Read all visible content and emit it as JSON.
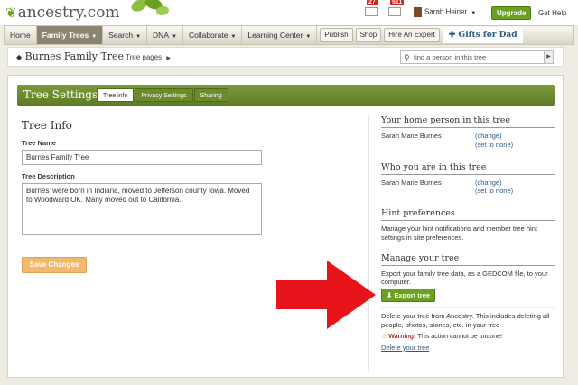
{
  "brand": {
    "logo_mark": "❦",
    "logo_text": "ancestry.com"
  },
  "header": {
    "notifications": [
      {
        "count": "27",
        "icon": "envelope-icon"
      },
      {
        "count": "511",
        "icon": "envelope-icon"
      }
    ],
    "user_name": "Sarah Heiner",
    "upgrade_label": "Upgrade",
    "help_label": "Get Help"
  },
  "nav": {
    "items": [
      {
        "label": "Home",
        "dropdown": false
      },
      {
        "label": "Family Trees",
        "dropdown": true,
        "active": true
      },
      {
        "label": "Search",
        "dropdown": true
      },
      {
        "label": "DNA",
        "dropdown": true
      },
      {
        "label": "Collaborate",
        "dropdown": true
      },
      {
        "label": "Learning Center",
        "dropdown": true
      }
    ],
    "publish_label": "Publish",
    "shop_label": "Shop",
    "hire_label": "Hire An Expert",
    "promo_label": "Gifts for Dad",
    "caret": "▼"
  },
  "subbar": {
    "tree_name": "Burnes Family Tree",
    "tree_pages_label": "Tree pages",
    "search_placeholder": "find a person in this tree"
  },
  "panel": {
    "title": "Tree Settings",
    "tabs": [
      {
        "label": "Tree info",
        "active": true
      },
      {
        "label": "Privacy Settings"
      },
      {
        "label": "Sharing"
      }
    ]
  },
  "tree_info": {
    "heading": "Tree Info",
    "name_label": "Tree Name",
    "name_value": "Burnes Family Tree",
    "desc_label": "Tree Description",
    "desc_value": "Burnes' were born in Indiana, moved to Jefferson county Iowa. Moved to Woodward OK. Many moved out to California.",
    "save_label": "Save Changes"
  },
  "sidebar": {
    "home_person": {
      "heading": "Your home person in this tree",
      "name": "Sarah Marie Burnes",
      "change": "(change)",
      "set_none": "(set to none)"
    },
    "who_you_are": {
      "heading": "Who you are in this tree",
      "name": "Sarah Marie Burnes",
      "change": "(change)",
      "set_none": "(set to none)"
    },
    "hints": {
      "heading": "Hint preferences",
      "text": "Manage your hint notifications and member tree hint settings in site preferences."
    },
    "manage": {
      "heading": "Manage your tree",
      "export_text": "Export your family tree data, as a GEDCOM file, to your computer.",
      "export_label": "Export tree",
      "delete_text": "Delete your tree from Ancestry. This includes deleting all people, photos, stories, etc. in your tree",
      "warning_label": "Warning!",
      "warning_text": "This action cannot be undone!",
      "delete_link": "Delete your tree"
    }
  },
  "colors": {
    "accent_green": "#6aa121",
    "arrow_red": "#e8141c",
    "save_orange": "#f2b86b"
  }
}
